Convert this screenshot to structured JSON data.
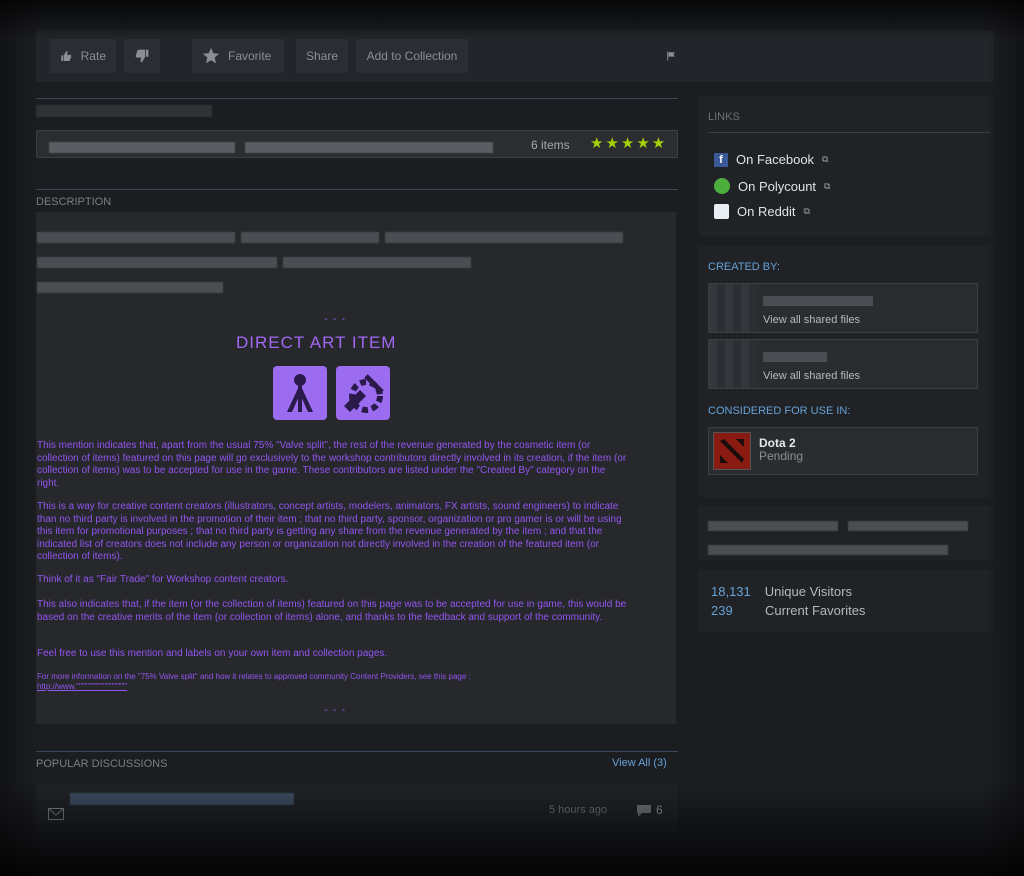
{
  "toolbar": {
    "rate": "Rate",
    "favorite": "Favorite",
    "share": "Share",
    "add_to_collection": "Add to Collection"
  },
  "item": {
    "items_count": "6 items",
    "stars": "★★★★★"
  },
  "description": {
    "title": "DESCRIPTION",
    "dots": "- - -",
    "direct_art_title": "DIRECT ART ITEM",
    "paragraphs": [
      "This mention indicates that, apart from the usual 75% \"Valve split\", the rest of the revenue generated by the cosmetic item (or collection of items) featured on this page will go exclusively to the workshop contributors directly involved in its creation, if the item (or collection of items) was to be accepted for use in the game. These contributors are listed under the \"Created By\" category on the right.",
      "This is a way for creative content creators (illustrators, concept artists, modelers, animators, FX artists, sound engineers) to indicate than no third party is involved in the promotion of their item ; that no third party, sponsor, organization or pro gamer is or will be using this item for promotional purposes ; that no third party is getting any share from the revenue generated by the item ; and that the indicated list of creators does not include any person or organization not directly involved in the creation of the featured item (or collection of items).",
      "Think of it as \"Fair Trade\" for Workshop content creators.",
      "This also indicates that, if the item (or the collection of items) featured on this page was to be accepted for use in game, this would be based on the creative merits of the item (or collection of items) alone, and thanks to the feedback and support of the community.",
      "Feel free to use this mention and labels on your own item and collection pages."
    ],
    "footnote": "For more information on the \"75% Valve split\" and how it relates to approved community Content Providers, see this page :",
    "footnote_link": "http://www.\"\"\"\"\"\"\"\"\"\"\"\"\"\"\"\"\"\""
  },
  "discussions": {
    "title": "POPULAR DISCUSSIONS",
    "view_all": "View All (3)",
    "time": "5 hours ago",
    "count": "6"
  },
  "links": {
    "title": "LINKS",
    "items": [
      {
        "label": "On Facebook",
        "icon": "facebook-icon"
      },
      {
        "label": "On Polycount",
        "icon": "polycount-icon"
      },
      {
        "label": "On Reddit",
        "icon": "reddit-icon"
      }
    ]
  },
  "created_by": {
    "title": "CREATED BY:",
    "creators": [
      {
        "sub": "View all shared files"
      },
      {
        "sub": "View all shared files"
      }
    ]
  },
  "considered": {
    "title": "CONSIDERED FOR USE IN:",
    "game": "Dota 2",
    "status": "Pending"
  },
  "stats": {
    "visitors_num": "18,131",
    "visitors_label": "Unique Visitors",
    "favorites_num": "239",
    "favorites_label": "Current Favorites"
  },
  "colors": {
    "accent_blue": "#66a2d8",
    "purple": "#9e5ff0",
    "star_green": "#a4d007"
  }
}
